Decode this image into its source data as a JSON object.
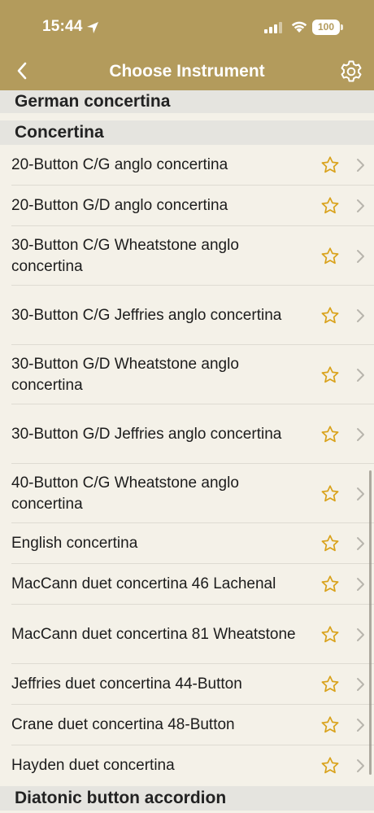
{
  "status": {
    "time": "15:44",
    "battery": "100"
  },
  "nav": {
    "title": "Choose Instrument"
  },
  "sections": {
    "german": "German concertina",
    "concertina": "Concertina",
    "diatonic": "Diatonic button accordion"
  },
  "items": [
    "20-Button C/G anglo concertina",
    "20-Button G/D anglo concertina",
    "30-Button C/G Wheatstone anglo concertina",
    "30-Button C/G Jeffries anglo concertina",
    "30-Button G/D Wheatstone anglo concertina",
    "30-Button G/D Jeffries anglo concertina",
    "40-Button C/G Wheatstone anglo concertina",
    "English concertina",
    "MacCann duet concertina 46 Lachenal",
    "MacCann duet concertina 81 Wheatstone",
    "Jeffries duet concertina 44-Button",
    "Crane duet concertina 48-Button",
    "Hayden duet concertina"
  ],
  "colors": {
    "header": "#b39b5c",
    "background": "#f4f1e8",
    "section": "#e5e4df",
    "star": "#d9a21b"
  },
  "icons": {
    "favorite": "star-outline-icon",
    "disclosure": "chevron-right-icon"
  }
}
